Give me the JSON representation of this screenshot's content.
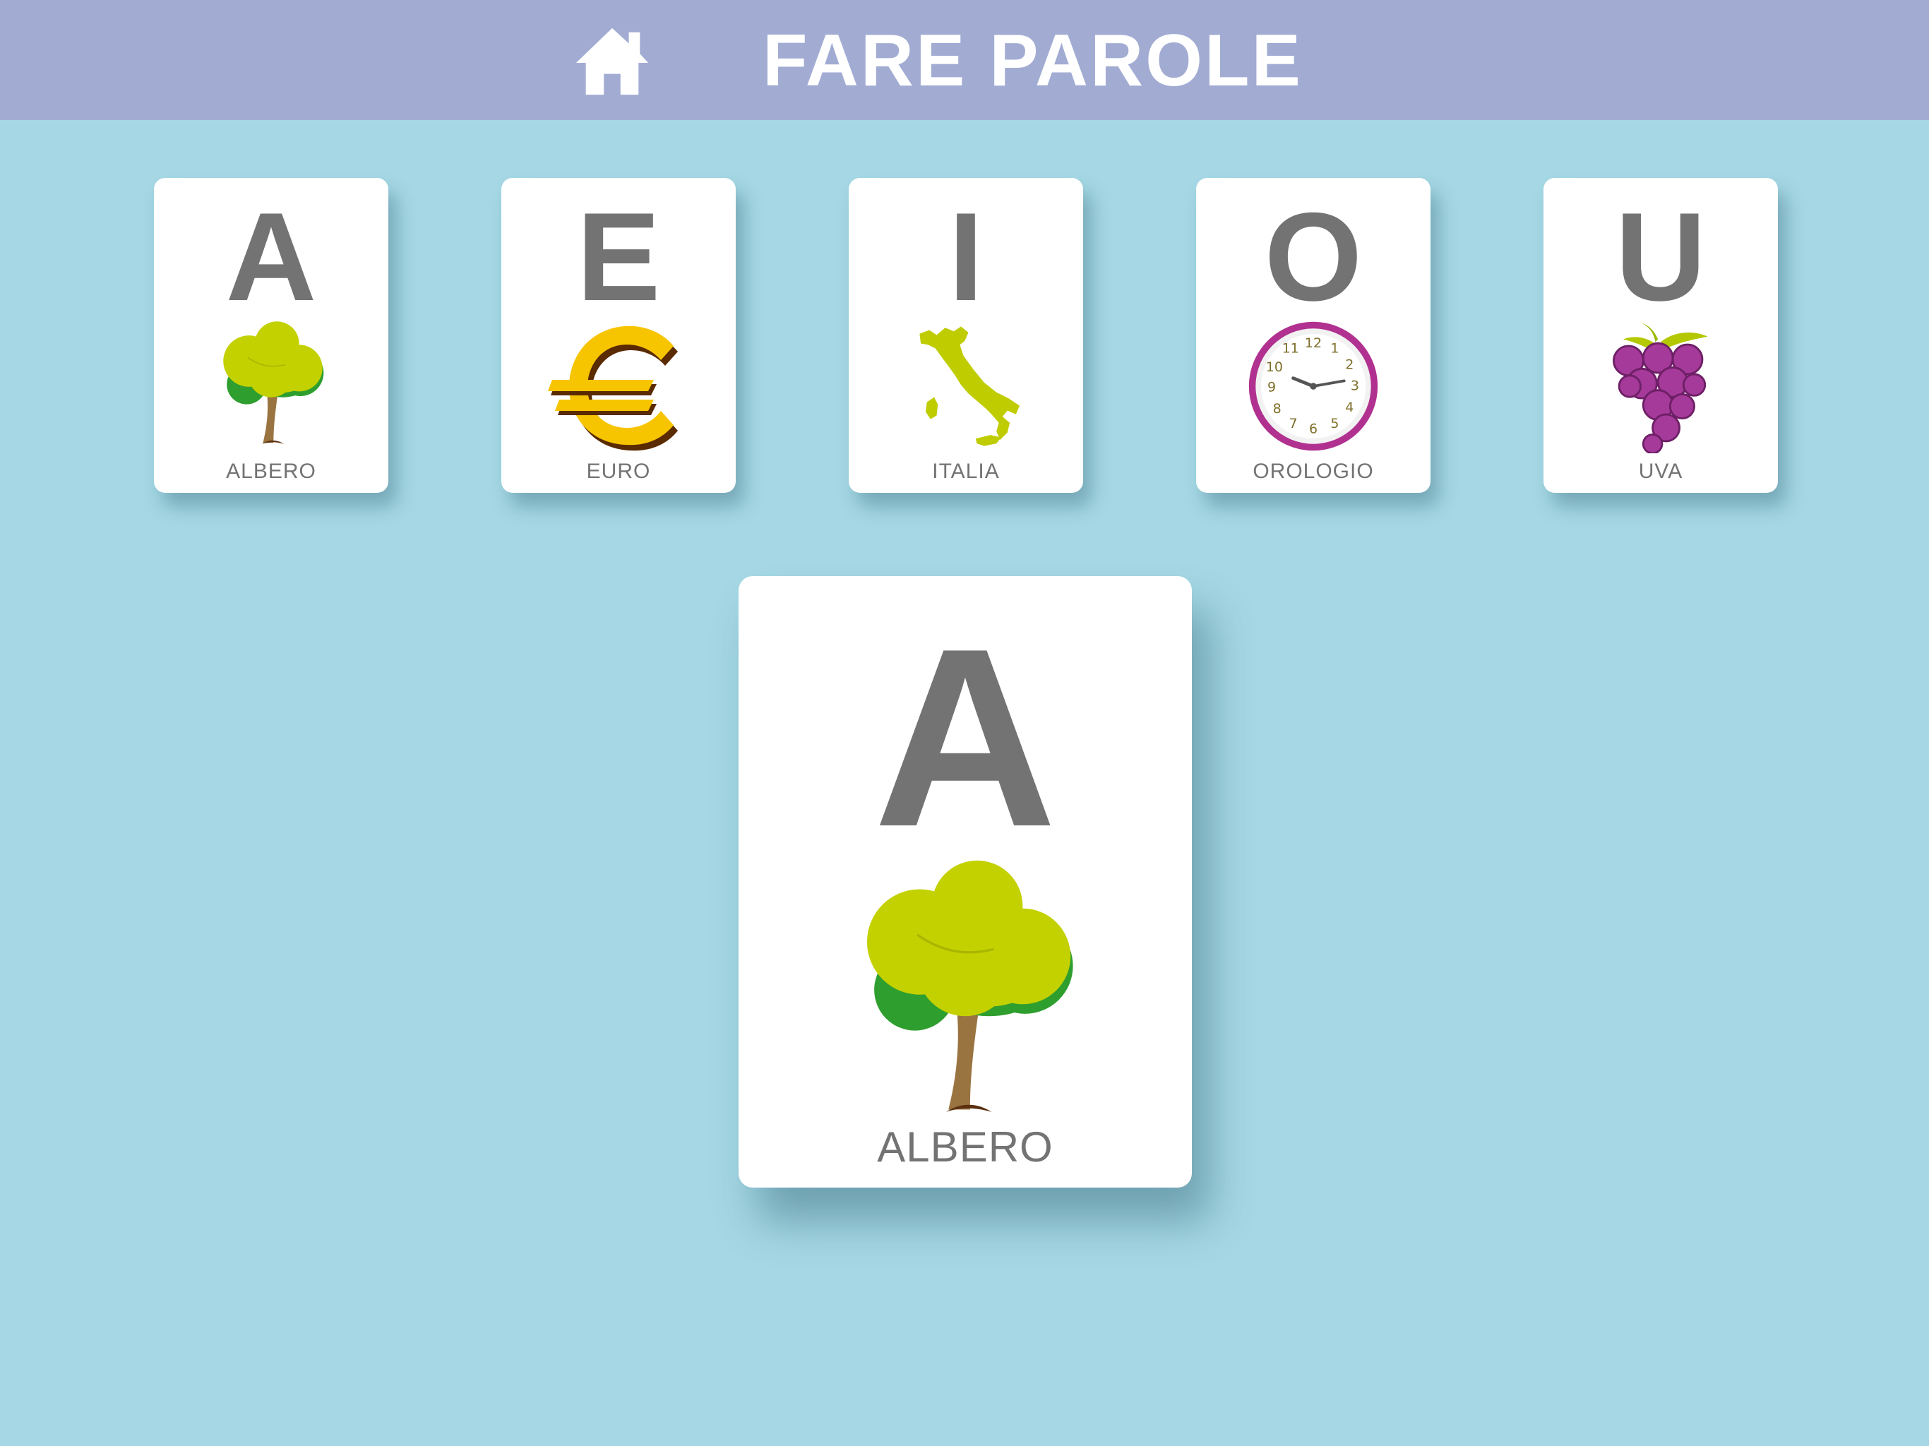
{
  "colors": {
    "background": "#a5d8e4",
    "header": "#a2acd3",
    "header_text": "#ffffff",
    "card_text": "#737373"
  },
  "header": {
    "home_icon": "home-icon",
    "title": "FARE PAROLE"
  },
  "cards": [
    {
      "letter": "A",
      "word": "ALBERO",
      "icon": "tree-icon"
    },
    {
      "letter": "E",
      "word": "EURO",
      "icon": "euro-icon"
    },
    {
      "letter": "I",
      "word": "ITALIA",
      "icon": "italy-map-icon"
    },
    {
      "letter": "O",
      "word": "OROLOGIO",
      "icon": "clock-icon"
    },
    {
      "letter": "U",
      "word": "UVA",
      "icon": "grapes-icon"
    }
  ],
  "selected_card": {
    "letter": "A",
    "word": "ALBERO",
    "icon": "tree-icon"
  }
}
